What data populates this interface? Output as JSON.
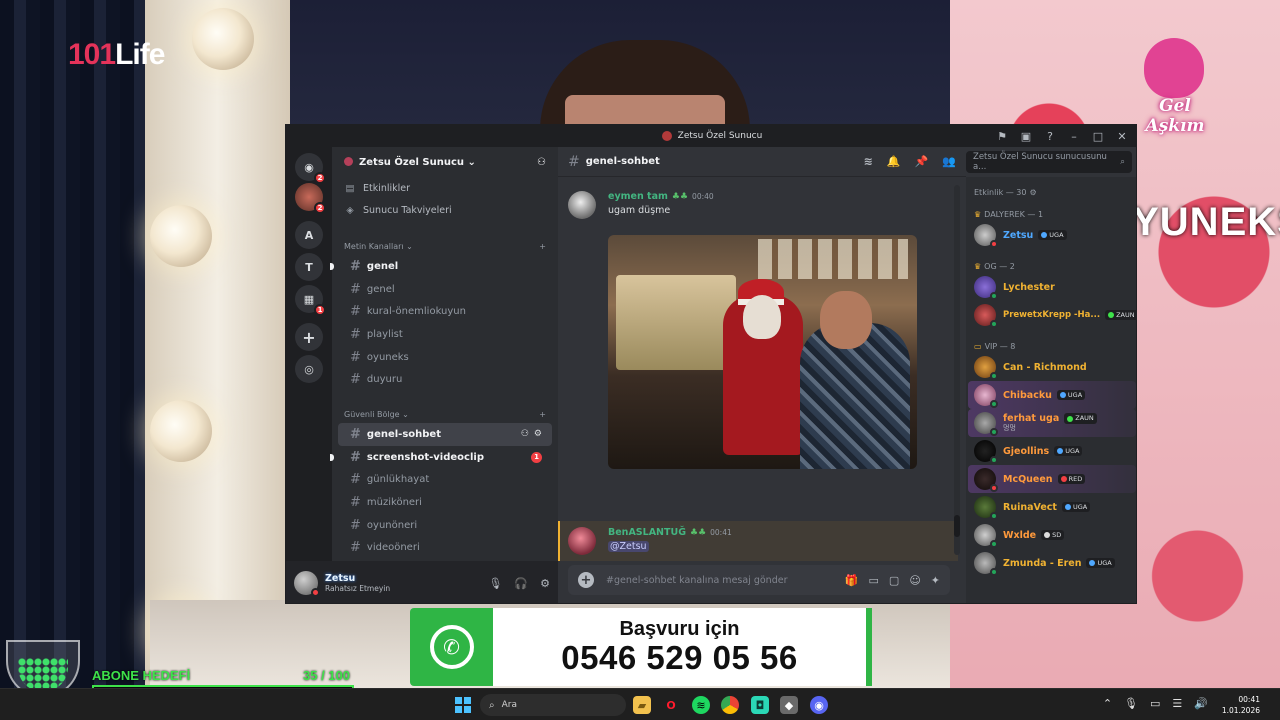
{
  "stream": {
    "channel_logo": {
      "number": "101",
      "word": "Life"
    },
    "corner_logo_text": "Gel Aşkım",
    "sponsor_text": "OYUNEKS",
    "whatsapp": {
      "title": "Başvuru için",
      "phone": "0546 529 05 56"
    },
    "subscriber_goal": {
      "label": "ABONE HEDEFİ",
      "count": "35 / 100",
      "progress": 0.35
    }
  },
  "window": {
    "title": "Zetsu Özel Sunucu",
    "server_name": "Zetsu Özel Sunucu",
    "rail": [
      {
        "name": "discord-home",
        "badge": "2"
      },
      {
        "name": "avatar-server",
        "badge": "2"
      },
      {
        "name": "server-a",
        "label": "A"
      },
      {
        "name": "server-t",
        "label": "T"
      },
      {
        "name": "server-folder",
        "badge": "1"
      }
    ],
    "links": [
      {
        "label": "Etkinlikler",
        "icon": "calendar-icon"
      },
      {
        "label": "Sunucu Takviyeleri",
        "icon": "boost-icon"
      }
    ],
    "categories": {
      "text": "Metin Kanalları",
      "safe": "Güvenli Bölge"
    },
    "text_channels": [
      {
        "label": "genel",
        "state": "unread"
      },
      {
        "label": "genel",
        "state": ""
      },
      {
        "label": "kural-önemliokuyun",
        "state": ""
      },
      {
        "label": "playlist",
        "state": ""
      },
      {
        "label": "oyuneks",
        "state": ""
      },
      {
        "label": "duyuru",
        "state": ""
      }
    ],
    "safe_channels": [
      {
        "label": "genel-sohbet",
        "state": "active"
      },
      {
        "label": "screenshot-videoclip",
        "state": "unread",
        "mention": "1"
      },
      {
        "label": "günlükhayat",
        "state": ""
      },
      {
        "label": "müzikönerі",
        "state": ""
      },
      {
        "label": "oyunöneri",
        "state": ""
      },
      {
        "label": "videoöneri",
        "state": ""
      }
    ],
    "user": {
      "name": "Zetsu",
      "status": "Rahatsız Etmeyin"
    },
    "chat_channel": "genel-sohbet",
    "search_placeholder": "Zetsu Özel Sunucu sunucusunu a...",
    "composer_placeholder": "#genel-sohbet kanalına mesaj gönder",
    "messages": [
      {
        "author": "eymen tam",
        "time": "00:40",
        "text": "ugam düşme"
      },
      {
        "author": "BenASLANTUĞ",
        "time": "00:41",
        "mention": "@Zetsu"
      }
    ],
    "members": {
      "header": "Etkinlik — 30",
      "groups": [
        {
          "title": "DALYEREK — 1",
          "items": [
            {
              "name": "Zetsu",
              "color": "#4fa8ff",
              "tag": "UGA",
              "status": "#f23f43"
            }
          ]
        },
        {
          "title": "OG — 2",
          "items": [
            {
              "name": "Lychester",
              "color": "#f0b232",
              "status": "#23a55a"
            },
            {
              "name": "PrewetxKrepp -Ha...",
              "color": "#f0b232",
              "tag": "ZAUN",
              "status": "#23a55a"
            }
          ]
        },
        {
          "title": "VIP — 8",
          "items": [
            {
              "name": "Can - Richmond",
              "color": "#f0b232",
              "status": "#23a55a"
            },
            {
              "name": "Chibacku",
              "color": "#ff9a3c",
              "tag": "UGA",
              "status": "#23a55a",
              "hl": true
            },
            {
              "name": "ferhat uga",
              "color": "#ff9a3c",
              "tag": "ZAUN",
              "status": "#23a55a",
              "sub": "멍멍",
              "hl": true
            },
            {
              "name": "Gjeollins",
              "color": "#ff9a3c",
              "tag": "UGA",
              "status": "#23a55a"
            },
            {
              "name": "McQueen",
              "color": "#ff9a3c",
              "tag": "RED",
              "status": "#f23f43",
              "hl": true
            },
            {
              "name": "RuinaVect",
              "color": "#f0b232",
              "tag": "UGA",
              "status": "#23a55a"
            },
            {
              "name": "Wxlde",
              "color": "#ff9a3c",
              "tag": "SD",
              "status": "#23a55a"
            },
            {
              "name": "Zmunda - Eren",
              "color": "#f0b232",
              "tag": "UGA",
              "status": "#23a55a"
            }
          ]
        }
      ]
    }
  },
  "taskbar": {
    "search_label": "Ara",
    "time": "00:41",
    "date": "1.01.2026"
  }
}
